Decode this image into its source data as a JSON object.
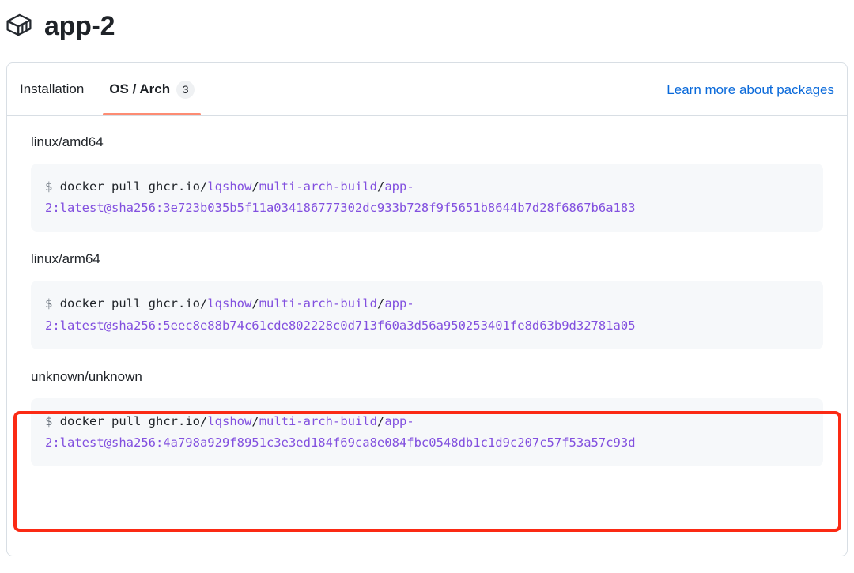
{
  "header": {
    "icon": "package-cube-icon",
    "title": "app-2"
  },
  "tabs": [
    {
      "label": "Installation",
      "active": false,
      "count": null
    },
    {
      "label": "OS / Arch",
      "active": true,
      "count": "3"
    }
  ],
  "links": {
    "learn_more": "Learn more about packages"
  },
  "registry": {
    "prompt": "$",
    "command": "docker pull ",
    "host": "ghcr.io",
    "owner": "lqshow",
    "repo": "multi-arch-build",
    "image_prefix": "app-",
    "tag_and_digest_prefix": "2:latest@sha256:"
  },
  "platforms": [
    {
      "label": "linux/amd64",
      "digest": "3e723b035b5f11a034186777302dc933b728f9f5651b8644b7d28f6867b6a183",
      "highlighted": false,
      "line1_prompt": "$",
      "line1_cmd": "docker pull ",
      "line1_host": "ghcr.io",
      "line1_sep1": "/",
      "line1_owner": "lqshow",
      "line1_sep2": "/",
      "line1_repo": "multi-arch-build",
      "line1_sep3": "/",
      "line1_app": "app-",
      "line2": "2:latest@sha256:3e723b035b5f11a034186777302dc933b728f9f5651b8644b7d28f6867b6a183"
    },
    {
      "label": "linux/arm64",
      "digest": "5eec8e88b74c61cde802228c0d713f60a3d56a950253401fe8d63b9d32781a05",
      "highlighted": false,
      "line1_prompt": "$",
      "line1_cmd": "docker pull ",
      "line1_host": "ghcr.io",
      "line1_sep1": "/",
      "line1_owner": "lqshow",
      "line1_sep2": "/",
      "line1_repo": "multi-arch-build",
      "line1_sep3": "/",
      "line1_app": "app-",
      "line2": "2:latest@sha256:5eec8e88b74c61cde802228c0d713f60a3d56a950253401fe8d63b9d32781a05"
    },
    {
      "label": "unknown/unknown",
      "digest": "4a798a929f8951c3e3ed184f69ca8e084fbc0548db1c1d9c207c57f53a57c93d",
      "highlighted": true,
      "line1_prompt": "$",
      "line1_cmd": "docker pull ",
      "line1_host": "ghcr.io",
      "line1_sep1": "/",
      "line1_owner": "lqshow",
      "line1_sep2": "/",
      "line1_repo": "multi-arch-build",
      "line1_sep3": "/",
      "line1_app": "app-",
      "line2": "2:latest@sha256:4a798a929f8951c3e3ed184f69ca8e084fbc0548db1c1d9c207c57f53a57c93d"
    }
  ],
  "colors": {
    "accent_link": "#0969da",
    "tab_underline": "#fd8c73",
    "code_reference": "#8250df",
    "highlight_border": "#fb2a14",
    "code_background": "#f6f8fa",
    "card_border": "#d8dee4"
  }
}
